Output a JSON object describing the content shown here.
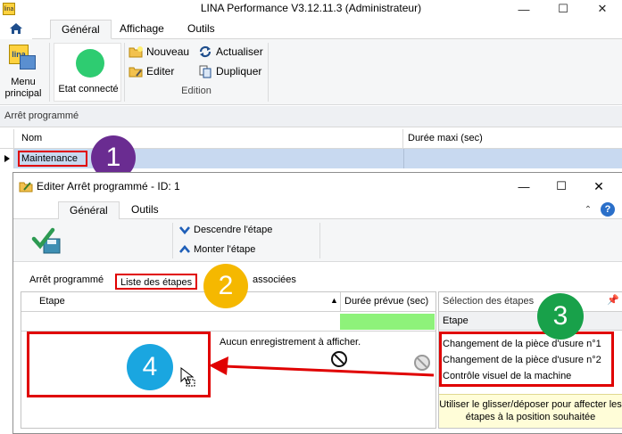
{
  "window": {
    "title": "LINA Performance  V3.12.11.3  (Administrateur)",
    "minimize_glyph": "—",
    "maximize_glyph": "☐",
    "close_glyph": "✕"
  },
  "main_ribbon": {
    "tabs": [
      "Général",
      "Affichage",
      "Outils"
    ],
    "active_tab": "Général",
    "menu_button": {
      "label_line1": "Menu",
      "label_line2": "principal",
      "logo_text": "lina"
    },
    "status": {
      "label": "Etat connecté",
      "color": "#2ecc71"
    },
    "edition": {
      "group_label": "Edition",
      "nouveau": "Nouveau",
      "editer": "Editer",
      "actualiser": "Actualiser",
      "dupliquer": "Dupliquer"
    }
  },
  "main_grid": {
    "section_title": "Arrêt programmé",
    "columns": [
      "Nom",
      "Durée maxi (sec)"
    ],
    "rows": [
      {
        "nom": "Maintenance",
        "duree": ""
      }
    ]
  },
  "dialog": {
    "title": "Editer Arrêt programmé - ID: 1",
    "tabs": [
      "Général",
      "Outils"
    ],
    "active_tab": "Général",
    "actions": {
      "descendre": "Descendre l'étape",
      "monter": "Monter l'étape"
    },
    "subtabs": {
      "arret": "Arrêt programmé",
      "liste": "Liste des étapes",
      "associees": "associées"
    },
    "steps_table": {
      "columns": [
        "Etape",
        "Durée prévue (sec)"
      ],
      "empty_text": "Aucun enregistrement à afficher."
    },
    "selection_panel": {
      "title": "Sélection des étapes",
      "column": "Etape",
      "items": [
        "Changement de la pièce d'usure n°1",
        "Changement de la pièce d'usure n°2",
        "Contrôle visuel de la machine"
      ],
      "hint": "Utiliser le glisser/déposer pour affecter les étapes à la position souhaitée"
    }
  },
  "annotations": {
    "badges": [
      {
        "number": "1",
        "color": "#6a2c91"
      },
      {
        "number": "2",
        "color": "#f5b800"
      },
      {
        "number": "3",
        "color": "#18a14a"
      },
      {
        "number": "4",
        "color": "#1aa6e0"
      }
    ],
    "highlight_color": "#e00000"
  }
}
